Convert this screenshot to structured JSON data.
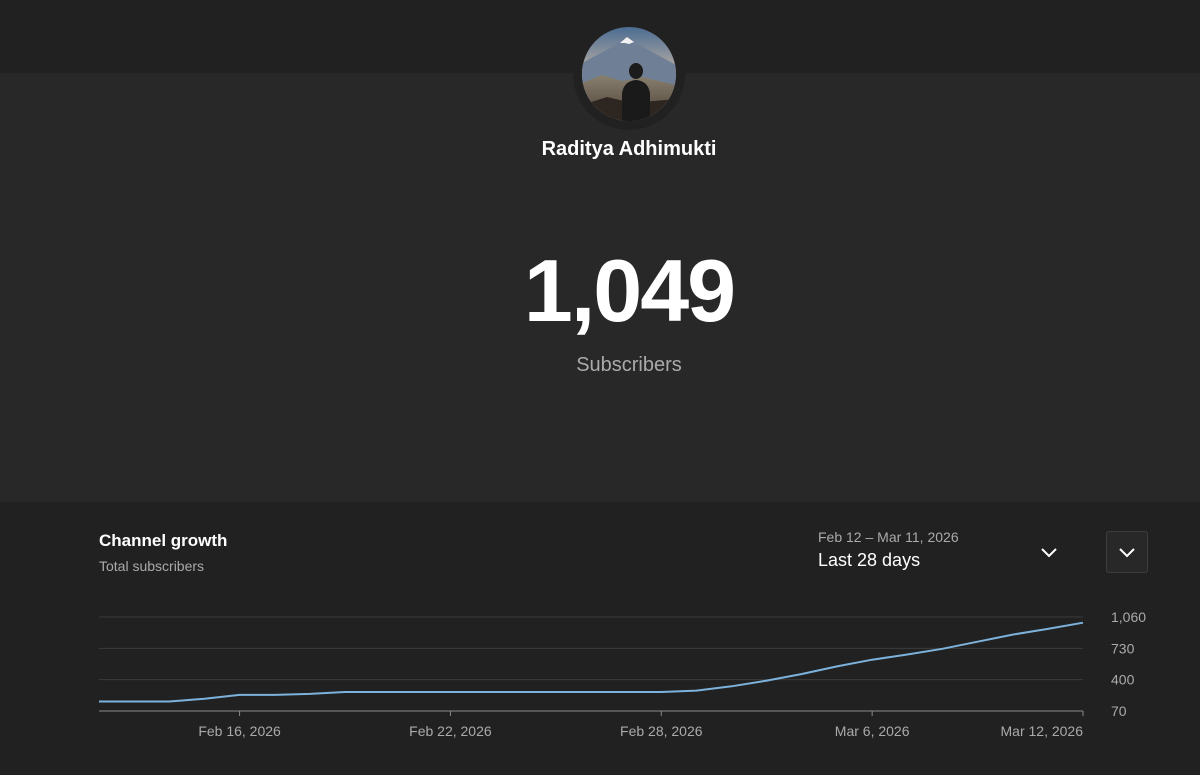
{
  "channel": {
    "name": "Raditya Adhimukti",
    "subscriber_count": "1,049",
    "subscriber_label": "Subscribers"
  },
  "growth": {
    "title": "Channel growth",
    "subtitle": "Total subscribers",
    "date_range": "Feb 12 – Mar 11, 2026",
    "range_label": "Last 28 days",
    "range_icon": "chevron-down-icon",
    "expand_icon": "chevron-down-icon"
  },
  "colors": {
    "background": "#282828",
    "panel": "#212121",
    "line": "#7cb2dc",
    "gridline": "#3c3c3c",
    "muted_text": "#aaaaaa"
  },
  "chart_data": {
    "type": "line",
    "title": "",
    "xlabel": "",
    "ylabel": "",
    "x_ticks": [
      "Feb 16, 2026",
      "Feb 22, 2026",
      "Feb 28, 2026",
      "Mar 6, 2026",
      "Mar 12, 2026"
    ],
    "y_ticks": [
      "1,060",
      "730",
      "400",
      "70"
    ],
    "ylim": [
      70,
      1060
    ],
    "xlim": [
      "2026-02-12",
      "2026-03-12"
    ],
    "grid": true,
    "series": [
      {
        "x": [
          "2026-02-12",
          "2026-02-13",
          "2026-02-14",
          "2026-02-15",
          "2026-02-16",
          "2026-02-17",
          "2026-02-18",
          "2026-02-19",
          "2026-02-20",
          "2026-02-21",
          "2026-02-22",
          "2026-02-23",
          "2026-02-24",
          "2026-02-25",
          "2026-02-26",
          "2026-02-27",
          "2026-02-28",
          "2026-03-01",
          "2026-03-02",
          "2026-03-03",
          "2026-03-04",
          "2026-03-05",
          "2026-03-06",
          "2026-03-07",
          "2026-03-08",
          "2026-03-09",
          "2026-03-10",
          "2026-03-11",
          "2026-03-12"
        ],
        "values": [
          170,
          170,
          170,
          200,
          240,
          240,
          250,
          270,
          270,
          270,
          270,
          270,
          270,
          270,
          270,
          270,
          270,
          285,
          330,
          390,
          460,
          540,
          610,
          665,
          725,
          800,
          875,
          935,
          1000
        ]
      }
    ]
  }
}
